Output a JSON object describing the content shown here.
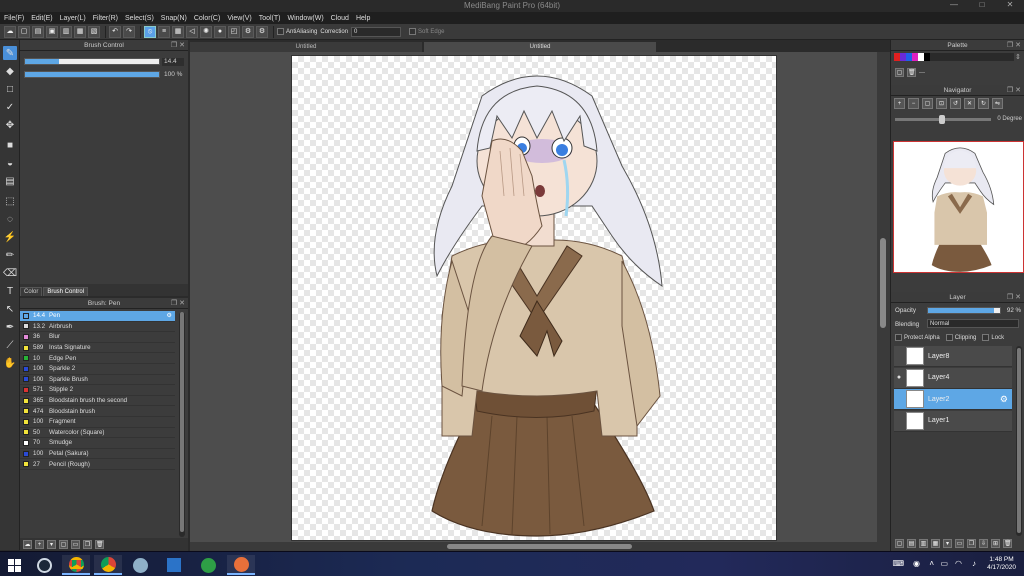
{
  "window": {
    "title": "MediBang Paint Pro (64bit)",
    "min": "—",
    "max": "□",
    "close": "✕"
  },
  "menu": [
    "File(F)",
    "Edit(E)",
    "Layer(L)",
    "Filter(R)",
    "Select(S)",
    "Snap(N)",
    "Color(C)",
    "View(V)",
    "Tool(T)",
    "Window(W)",
    "Cloud",
    "Help"
  ],
  "toolbar": {
    "antialias_label": "AntiAliasing",
    "correction_label": "Correction",
    "correction_value": "0",
    "softedge_label": "Soft Edge"
  },
  "brush_control": {
    "title": "Brush Control",
    "size_value": "14.4",
    "size_fraction": 0.25,
    "opacity_value": "100 %",
    "opacity_fraction": 1.0
  },
  "tabs": [
    "Color",
    "Brush Control"
  ],
  "brush_panel": {
    "title": "Brush: Pen",
    "items": [
      {
        "size": "14.4",
        "name": "Pen",
        "color": "#5ea7e5",
        "selected": true
      },
      {
        "size": "13.2",
        "name": "Airbrush",
        "color": "#dddddd"
      },
      {
        "size": "36",
        "name": "Blur",
        "color": "#e28ad8"
      },
      {
        "size": "589",
        "name": "Insta Signature",
        "color": "#f2e33a"
      },
      {
        "size": "10",
        "name": "Edge Pen",
        "color": "#27b336"
      },
      {
        "size": "100",
        "name": "Sparkle 2",
        "color": "#2a4ad6"
      },
      {
        "size": "100",
        "name": "Sparkle Brush",
        "color": "#2a4ad6"
      },
      {
        "size": "571",
        "name": "Stipple 2",
        "color": "#d83232"
      },
      {
        "size": "365",
        "name": "Bloodstain brush the second",
        "color": "#f2e33a"
      },
      {
        "size": "474",
        "name": "Bloodstain brush",
        "color": "#f2e33a"
      },
      {
        "size": "100",
        "name": "Fragment",
        "color": "#f2e33a"
      },
      {
        "size": "50",
        "name": "Watercolor (Square)",
        "color": "#f2e33a"
      },
      {
        "size": "70",
        "name": "Smudge",
        "color": "#ffffff"
      },
      {
        "size": "100",
        "name": "Petal (Sakura)",
        "color": "#2a4ad6"
      },
      {
        "size": "27",
        "name": "Pencil (Rough)",
        "color": "#f2e33a"
      }
    ]
  },
  "doc_tabs": [
    "Untitled",
    "Untitled"
  ],
  "palette": {
    "title": "Palette",
    "colors": [
      "#e02020",
      "#6a2ad8",
      "#2060e8",
      "#e020c0",
      "#ffffff",
      "#000000"
    ],
    "menu": "---"
  },
  "navigator": {
    "title": "Navigator",
    "rotation": "0 Degree"
  },
  "layer_panel": {
    "title": "Layer",
    "opacity_label": "Opacity",
    "opacity_value": "92 %",
    "opacity_fraction": 0.92,
    "blending_label": "Blending",
    "blending_value": "Normal",
    "protect_alpha": "Protect Alpha",
    "clipping": "Clipping",
    "lock": "Lock",
    "layers": [
      {
        "name": "Layer8"
      },
      {
        "name": "Layer4"
      },
      {
        "name": "Layer2",
        "selected": true
      },
      {
        "name": "Layer1"
      }
    ]
  },
  "taskbar": {
    "time": "1:48 PM",
    "date": "4/17/2020"
  }
}
